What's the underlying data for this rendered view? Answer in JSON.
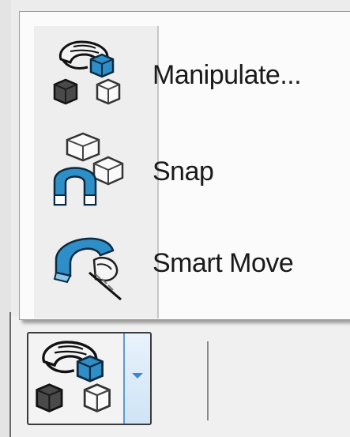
{
  "menu": {
    "items": [
      {
        "label": "Manipulate...",
        "icon": "manipulate-icon"
      },
      {
        "label": "Snap",
        "icon": "snap-magnet-icon"
      },
      {
        "label": "Smart Move",
        "icon": "smart-move-icon"
      }
    ]
  },
  "toolbar": {
    "split_button": {
      "icon": "manipulate-icon",
      "dropdown_icon": "chevron-down-icon"
    }
  },
  "colors": {
    "accent": "#2e8ec7",
    "divider": "#c6c6c6"
  }
}
